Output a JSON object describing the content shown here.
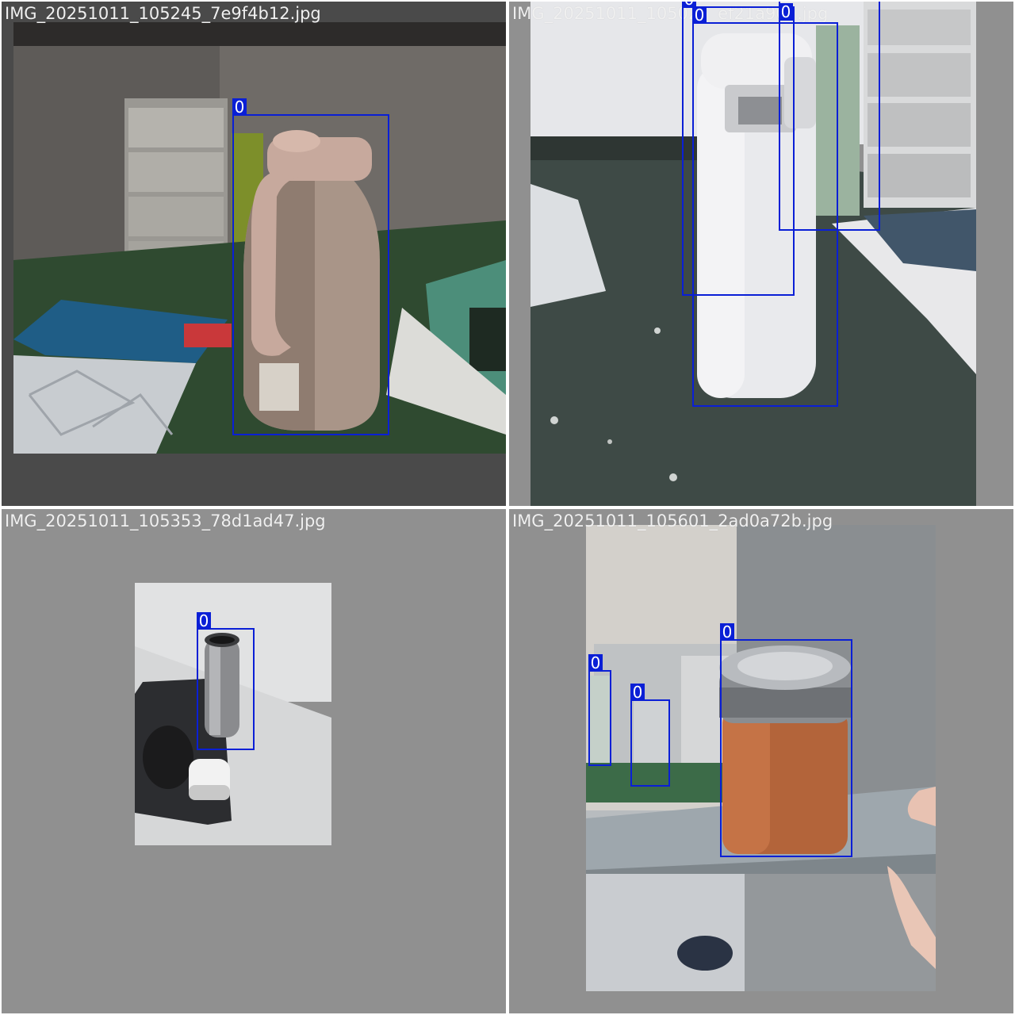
{
  "tiles": [
    {
      "filename": "IMG_20251011_105245_7e9f4b12.jpg",
      "detections": [
        {
          "class_label": "0"
        }
      ]
    },
    {
      "filename": "IMG_20251011_105027_ef21a907.jpg",
      "detections": [
        {
          "class_label": "0"
        },
        {
          "class_label": "0"
        },
        {
          "class_label": "0"
        }
      ]
    },
    {
      "filename": "IMG_20251011_105353_78d1ad47.jpg",
      "detections": [
        {
          "class_label": "0"
        }
      ]
    },
    {
      "filename": "IMG_20251011_105601_2ad0a72b.jpg",
      "detections": [
        {
          "class_label": "0"
        },
        {
          "class_label": "0"
        },
        {
          "class_label": "0"
        }
      ]
    }
  ],
  "colors": {
    "bbox": "#0a1fd6",
    "letterbox": "#909090",
    "filename_text": "#f0f0f0"
  }
}
